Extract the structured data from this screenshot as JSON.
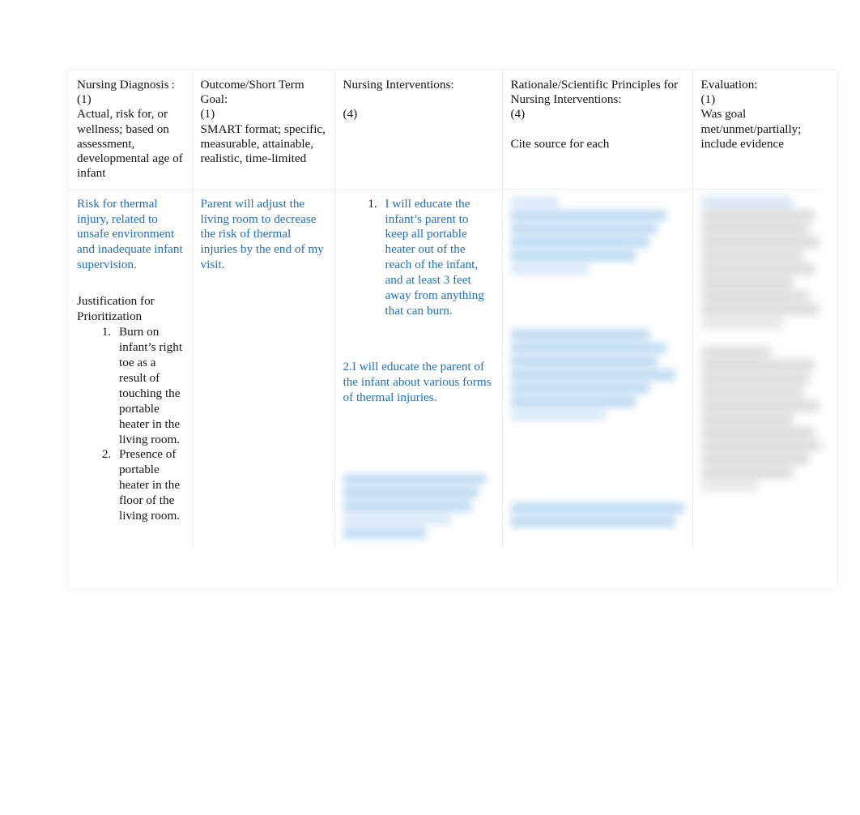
{
  "document": {
    "type": "nursing-care-plan-table",
    "columns": 5,
    "accent_color": "#1f70b8",
    "body_text_color": "#141414",
    "page_background": "#ffffff"
  },
  "headers": {
    "col1": "Nursing Diagnosis :\n(1)\nActual, risk for, or wellness; based on assessment, developmental age of infant",
    "col2": "Outcome/Short Term Goal:\n (1)\nSMART format; specific, measurable, attainable, realistic, time-limited",
    "col3": "Nursing Interventions:\n\n(4)",
    "col4": "Rationale/Scientific Principles for Nursing Interventions:\n(4)\n\nCite source for each",
    "col5": "Evaluation:\n(1)\nWas goal met/unmet/partially; include evidence"
  },
  "body": {
    "col1": {
      "diagnosis": "Risk for thermal injury, related to unsafe environment and inadequate infant supervision.",
      "justification_heading": "Justification for Prioritization",
      "justification_items": [
        "Burn on infant’s right toe as a result of touching the portable heater in the living room.",
        "Presence of portable heater in the floor of the living room."
      ]
    },
    "col2": {
      "goal": "Parent will adjust the living room to decrease the risk of thermal injuries by the end of my visit."
    },
    "col3": {
      "intervention_1": "I will educate the infant’s parent to keep all portable heater out of the reach of the infant, and at least 3 feet away from anything that can burn.",
      "intervention_2": "2.I will educate the parent of the infant about various forms of thermal injuries.",
      "intervention_3_redacted": "[blurred / illegible blue text block]"
    },
    "col4": {
      "rationale_1_redacted": "[blurred / illegible blue text block]",
      "rationale_2_redacted": "[blurred / illegible blue text block]",
      "rationale_3_redacted": "[blurred / illegible blue text block]"
    },
    "col5": {
      "evaluation_1_redacted": "[blurred / illegible gray text block]",
      "evaluation_2_redacted": "[blurred / illegible gray text block]"
    }
  }
}
